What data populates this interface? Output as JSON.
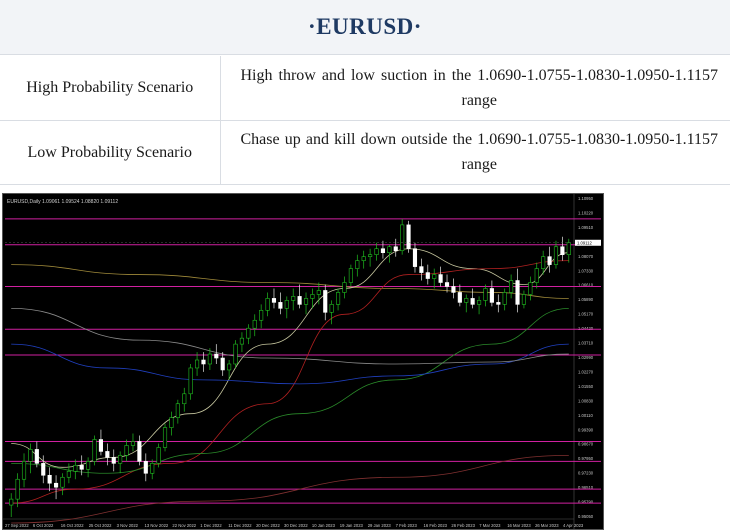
{
  "page": {
    "title": "·EURUSD·"
  },
  "scenarios": [
    {
      "label": "High Probability Scenario",
      "text": "High throw and low suction in the 1.0690-1.0755-1.0830-1.0950-1.1157 range"
    },
    {
      "label": "Low Probability Scenario",
      "text": "Chase up and kill down outside the 1.0690-1.0755-1.0830-1.0950-1.1157 range"
    }
  ],
  "chart_data": {
    "type": "candlestick",
    "header": "EURUSD,Daily  1.09061 1.09524 1.08820 1.09112",
    "ylim": [
      0.9525,
      1.1095
    ],
    "y_ticks": [
      "1.10950",
      "1.10220",
      "1.09510",
      "1.08790",
      "1.08070",
      "1.07330",
      "1.06610",
      "1.05890",
      "1.05170",
      "1.04420",
      "1.03710",
      "1.02990",
      "1.02270",
      "1.01550",
      "1.00830",
      "1.00110",
      "0.99390",
      "0.98670",
      "0.97950",
      "0.97230",
      "0.96510",
      "0.95790",
      "0.95050"
    ],
    "last_price_label": "1.09112",
    "x_labels": [
      "27 Sep 2022",
      "6 Oct 2022",
      "16 Oct 2022",
      "25 Oct 2022",
      "3 Nov 2022",
      "13 Nov 2022",
      "22 Nov 2022",
      "1 Dec 2022",
      "11 Dec 2022",
      "20 Dec 2022",
      "30 Dec 2022",
      "10 Jan 2023",
      "19 Jan 2023",
      "29 Jan 2023",
      "7 Feb 2023",
      "16 Feb 2023",
      "26 Feb 2023",
      "7 Mar 2023",
      "16 Mar 2023",
      "26 Mar 2023",
      "4 Apr 2023"
    ],
    "levels": [
      1.103,
      1.09,
      1.069,
      1.0475,
      1.0345,
      0.991,
      0.981,
      0.967,
      0.96,
      0.944
    ],
    "candles": [
      [
        0.959,
        0.965,
        0.953,
        0.962
      ],
      [
        0.962,
        0.975,
        0.958,
        0.972
      ],
      [
        0.972,
        0.985,
        0.968,
        0.981
      ],
      [
        0.981,
        0.99,
        0.975,
        0.987
      ],
      [
        0.987,
        0.991,
        0.978,
        0.98
      ],
      [
        0.98,
        0.984,
        0.97,
        0.974
      ],
      [
        0.974,
        0.978,
        0.966,
        0.97
      ],
      [
        0.97,
        0.974,
        0.962,
        0.968
      ],
      [
        0.968,
        0.975,
        0.964,
        0.973
      ],
      [
        0.973,
        0.98,
        0.97,
        0.976
      ],
      [
        0.976,
        0.982,
        0.972,
        0.979
      ],
      [
        0.979,
        0.984,
        0.974,
        0.977
      ],
      [
        0.977,
        0.983,
        0.973,
        0.981
      ],
      [
        0.981,
        0.994,
        0.979,
        0.992
      ],
      [
        0.992,
        0.997,
        0.984,
        0.986
      ],
      [
        0.986,
        0.99,
        0.979,
        0.983
      ],
      [
        0.983,
        0.987,
        0.976,
        0.98
      ],
      [
        0.98,
        0.986,
        0.975,
        0.984
      ],
      [
        0.984,
        0.992,
        0.981,
        0.989
      ],
      [
        0.989,
        0.995,
        0.986,
        0.991
      ],
      [
        0.991,
        0.994,
        0.979,
        0.981
      ],
      [
        0.981,
        0.985,
        0.971,
        0.975
      ],
      [
        0.975,
        0.982,
        0.972,
        0.98
      ],
      [
        0.98,
        0.99,
        0.978,
        0.988
      ],
      [
        0.988,
        1.0,
        0.986,
        0.998
      ],
      [
        0.998,
        1.006,
        0.994,
        1.003
      ],
      [
        1.003,
        1.012,
        1.0,
        1.01
      ],
      [
        1.01,
        1.018,
        1.006,
        1.015
      ],
      [
        1.015,
        1.03,
        1.012,
        1.028
      ],
      [
        1.028,
        1.036,
        1.024,
        1.032
      ],
      [
        1.032,
        1.036,
        1.026,
        1.03
      ],
      [
        1.03,
        1.038,
        1.027,
        1.035
      ],
      [
        1.035,
        1.04,
        1.03,
        1.033
      ],
      [
        1.033,
        1.036,
        1.024,
        1.027
      ],
      [
        1.027,
        1.032,
        1.022,
        1.03
      ],
      [
        1.03,
        1.042,
        1.028,
        1.04
      ],
      [
        1.04,
        1.046,
        1.036,
        1.043
      ],
      [
        1.043,
        1.05,
        1.04,
        1.048
      ],
      [
        1.048,
        1.055,
        1.044,
        1.052
      ],
      [
        1.052,
        1.06,
        1.048,
        1.057
      ],
      [
        1.057,
        1.066,
        1.054,
        1.063
      ],
      [
        1.063,
        1.068,
        1.058,
        1.061
      ],
      [
        1.061,
        1.066,
        1.055,
        1.058
      ],
      [
        1.058,
        1.064,
        1.053,
        1.062
      ],
      [
        1.062,
        1.068,
        1.057,
        1.064
      ],
      [
        1.064,
        1.07,
        1.058,
        1.06
      ],
      [
        1.06,
        1.066,
        1.055,
        1.063
      ],
      [
        1.063,
        1.068,
        1.058,
        1.065
      ],
      [
        1.065,
        1.071,
        1.06,
        1.067
      ],
      [
        1.067,
        1.07,
        1.052,
        1.056
      ],
      [
        1.056,
        1.062,
        1.05,
        1.06
      ],
      [
        1.06,
        1.068,
        1.057,
        1.066
      ],
      [
        1.066,
        1.074,
        1.063,
        1.071
      ],
      [
        1.071,
        1.08,
        1.069,
        1.078
      ],
      [
        1.078,
        1.085,
        1.074,
        1.082
      ],
      [
        1.082,
        1.087,
        1.078,
        1.084
      ],
      [
        1.084,
        1.088,
        1.079,
        1.085
      ],
      [
        1.085,
        1.091,
        1.082,
        1.088
      ],
      [
        1.088,
        1.092,
        1.083,
        1.086
      ],
      [
        1.086,
        1.09,
        1.081,
        1.089
      ],
      [
        1.089,
        1.093,
        1.084,
        1.087
      ],
      [
        1.087,
        1.103,
        1.085,
        1.1
      ],
      [
        1.1,
        1.102,
        1.086,
        1.088
      ],
      [
        1.088,
        1.091,
        1.076,
        1.079
      ],
      [
        1.079,
        1.083,
        1.072,
        1.076
      ],
      [
        1.076,
        1.08,
        1.07,
        1.073
      ],
      [
        1.073,
        1.078,
        1.068,
        1.075
      ],
      [
        1.075,
        1.079,
        1.069,
        1.071
      ],
      [
        1.071,
        1.075,
        1.066,
        1.069
      ],
      [
        1.069,
        1.073,
        1.063,
        1.066
      ],
      [
        1.066,
        1.07,
        1.059,
        1.061
      ],
      [
        1.061,
        1.065,
        1.056,
        1.063
      ],
      [
        1.063,
        1.068,
        1.058,
        1.06
      ],
      [
        1.06,
        1.064,
        1.055,
        1.062
      ],
      [
        1.062,
        1.07,
        1.059,
        1.068
      ],
      [
        1.068,
        1.072,
        1.059,
        1.061
      ],
      [
        1.061,
        1.065,
        1.056,
        1.06
      ],
      [
        1.06,
        1.068,
        1.057,
        1.066
      ],
      [
        1.066,
        1.075,
        1.063,
        1.072
      ],
      [
        1.072,
        1.078,
        1.056,
        1.06
      ],
      [
        1.06,
        1.067,
        1.058,
        1.065
      ],
      [
        1.065,
        1.074,
        1.062,
        1.071
      ],
      [
        1.071,
        1.081,
        1.068,
        1.078
      ],
      [
        1.078,
        1.087,
        1.075,
        1.084
      ],
      [
        1.084,
        1.089,
        1.076,
        1.08
      ],
      [
        1.08,
        1.092,
        1.078,
        1.089
      ],
      [
        1.089,
        1.094,
        1.082,
        1.085
      ],
      [
        1.085,
        1.093,
        1.081,
        1.091
      ]
    ],
    "moving_averages": [
      {
        "color": "#a08a3a",
        "points": [
          [
            0,
            1.08
          ],
          [
            20,
            1.075
          ],
          [
            40,
            1.071
          ],
          [
            60,
            1.068
          ],
          [
            75,
            1.066
          ],
          [
            87,
            1.063
          ]
        ]
      },
      {
        "color": "#c8c8a0",
        "points": [
          [
            0,
            0.99
          ],
          [
            8,
            0.978
          ],
          [
            16,
            0.983
          ],
          [
            28,
            1.005
          ],
          [
            40,
            1.04
          ],
          [
            52,
            1.068
          ],
          [
            62,
            1.088
          ],
          [
            72,
            1.078
          ],
          [
            80,
            1.07
          ],
          [
            87,
            1.086
          ]
        ]
      },
      {
        "color": "#b02020",
        "points": [
          [
            0,
            0.96
          ],
          [
            10,
            0.967
          ],
          [
            25,
            0.98
          ],
          [
            40,
            1.01
          ],
          [
            52,
            1.055
          ],
          [
            62,
            1.075
          ],
          [
            75,
            1.078
          ],
          [
            87,
            1.082
          ]
        ]
      },
      {
        "color": "#2a8a2a",
        "points": [
          [
            0,
            0.98
          ],
          [
            15,
            0.975
          ],
          [
            30,
            0.985
          ],
          [
            45,
            1.005
          ],
          [
            60,
            1.022
          ],
          [
            75,
            1.04
          ],
          [
            87,
            1.058
          ]
        ]
      },
      {
        "color": "#2040c0",
        "points": [
          [
            0,
            1.04
          ],
          [
            15,
            1.028
          ],
          [
            30,
            1.022
          ],
          [
            45,
            1.02
          ],
          [
            60,
            1.024
          ],
          [
            75,
            1.03
          ],
          [
            87,
            1.04
          ]
        ]
      },
      {
        "color": "#8a8a8a",
        "points": [
          [
            0,
            1.058
          ],
          [
            20,
            1.042
          ],
          [
            40,
            1.033
          ],
          [
            60,
            1.03
          ],
          [
            75,
            1.031
          ],
          [
            87,
            1.035
          ]
        ]
      },
      {
        "color": "#803030",
        "points": [
          [
            0,
            0.95
          ],
          [
            30,
            0.961
          ],
          [
            60,
            0.973
          ],
          [
            87,
            0.984
          ]
        ]
      }
    ]
  }
}
